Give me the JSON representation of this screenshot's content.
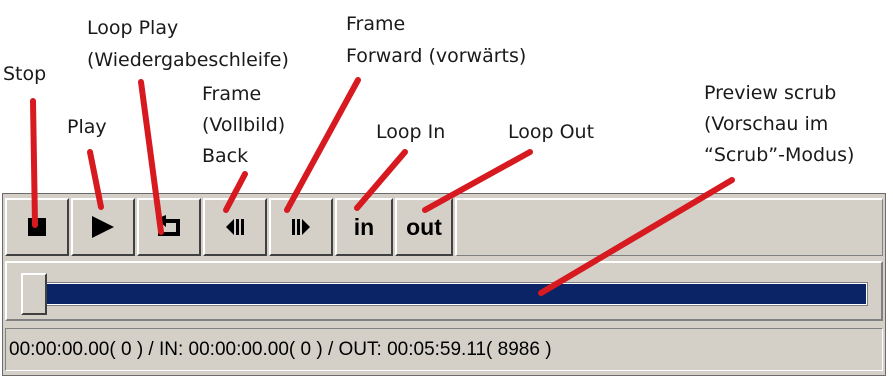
{
  "annotations": {
    "stop": "Stop",
    "play": "Play",
    "loop_play": "Loop Play\n(Wiedergabeschleife)",
    "frame_back": "Frame\n(Vollbild)\nBack",
    "frame_forward": "Frame\nForward (vorwärts)",
    "loop_in": "Loop In",
    "loop_out": "Loop Out",
    "preview_scrub": "Preview scrub\n(Vorschau im\n“Scrub”-Modus)"
  },
  "toolbar": {
    "in_label": "in",
    "out_label": "out"
  },
  "icons": {
    "stop": "stop-icon",
    "play": "play-icon",
    "loop": "loop-icon",
    "frame_back": "frame-back-icon",
    "frame_forward": "frame-forward-icon"
  },
  "colors": {
    "arrow": "#d71920",
    "track": "#0a2466",
    "panel": "#d4d0c8"
  },
  "scrubber": {
    "position": 0
  },
  "status": {
    "text": "00:00:00.00( 0 ) / IN: 00:00:00.00( 0 ) / OUT: 00:05:59.11( 8986 )"
  }
}
